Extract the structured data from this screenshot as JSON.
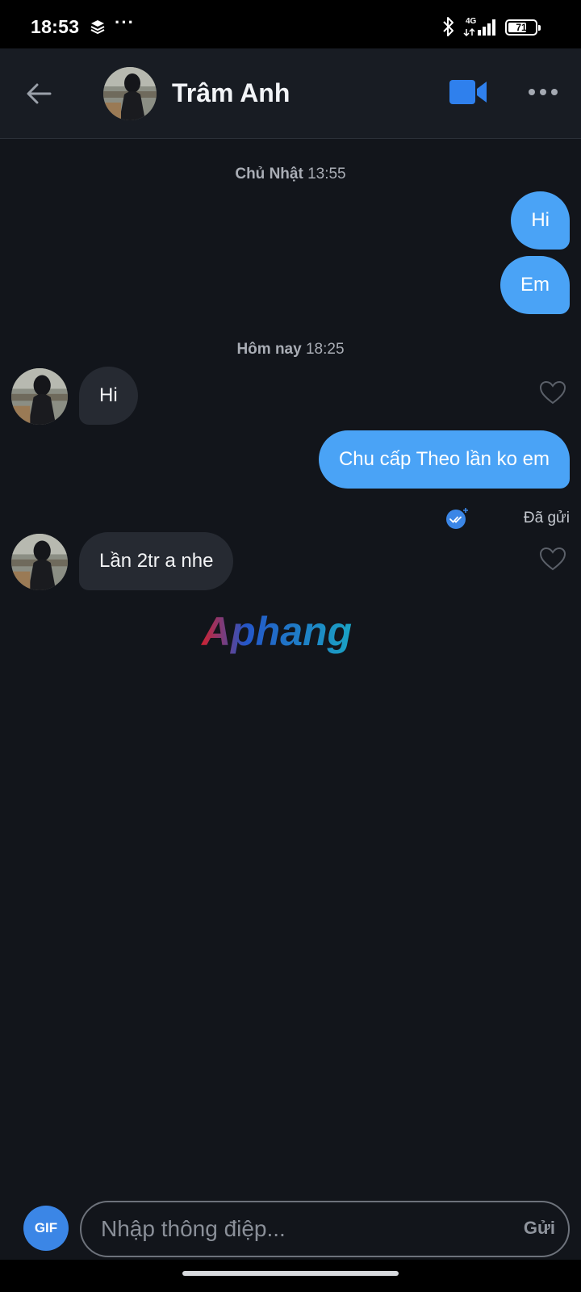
{
  "status_bar": {
    "time": "18:53",
    "extra_icons": "···",
    "network": "4G",
    "battery_level": "71",
    "battery_percent": 71
  },
  "header": {
    "contact_name": "Trâm Anh",
    "accent_color": "#2f80ed"
  },
  "conversation": [
    {
      "type": "date",
      "day": "Chủ Nhật",
      "time": "13:55"
    },
    {
      "type": "outgoing",
      "text": "Hi"
    },
    {
      "type": "outgoing",
      "text": "Em"
    },
    {
      "type": "date",
      "day": "Hôm nay",
      "time": "18:25"
    },
    {
      "type": "incoming",
      "text": "Hi"
    },
    {
      "type": "outgoing",
      "text": "Chu cấp Theo lần ko em",
      "status": "Đã gửi"
    },
    {
      "type": "incoming",
      "text": "Lần 2tr a nhe"
    }
  ],
  "watermark": "Aphang",
  "composer": {
    "gif_label": "GIF",
    "placeholder": "Nhập thông điệp...",
    "value": "",
    "send_label": "Gửi"
  },
  "colors": {
    "outgoing_bubble": "#4aa3f6",
    "incoming_bubble": "#262a32",
    "background": "#12151b"
  }
}
